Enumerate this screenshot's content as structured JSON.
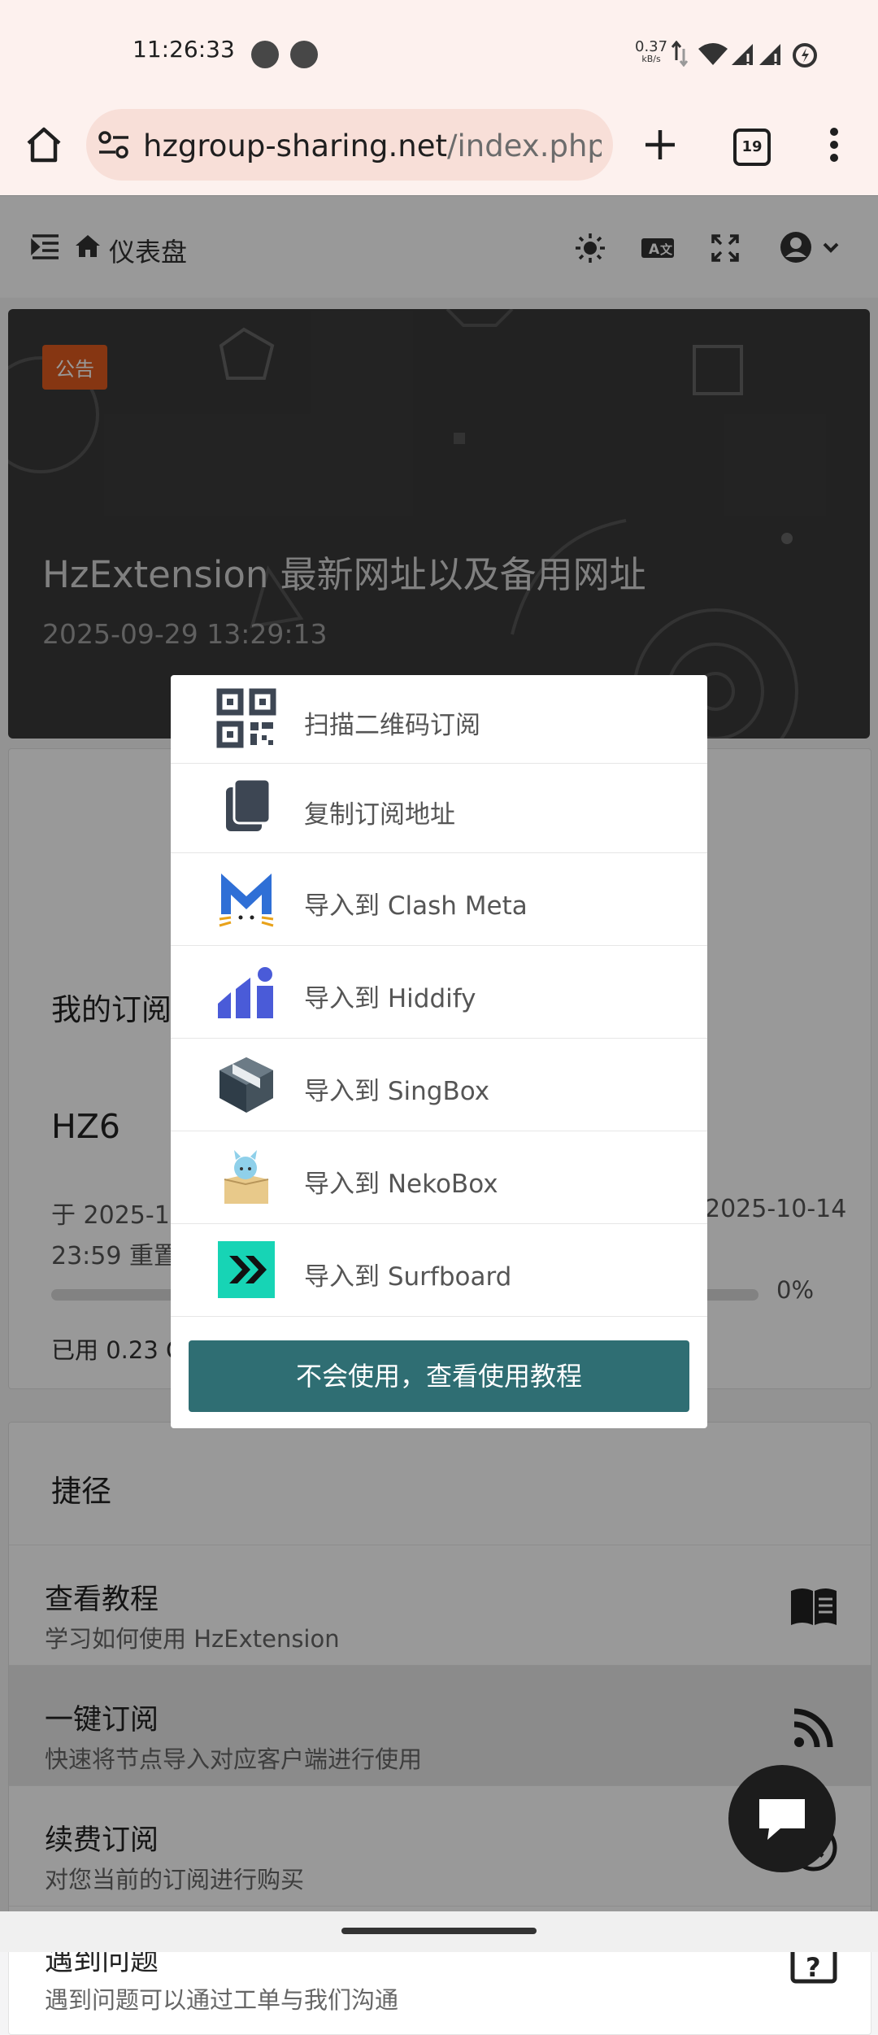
{
  "status": {
    "time": "11:26:33",
    "net_speed": "0.37",
    "net_unit": "kB/s"
  },
  "browser": {
    "url_main": "hzgroup-sharing.net",
    "url_rest": "/index.php#/da",
    "tab_count": "19"
  },
  "header": {
    "title": "仪表盘"
  },
  "announcement": {
    "badge": "公告",
    "title": "HzExtension 最新网址以及备用网址",
    "date": "2025-09-29 13:29:13"
  },
  "subscription": {
    "section_title": "我的订阅",
    "plan": "HZ6",
    "reset_line_left": "于 2025-10",
    "reset_line_right": "2025-10-14",
    "reset_line2": "23:59 重置",
    "usage_percent": "0%",
    "usage_fraction": 0,
    "used_text": "已用 0.23 G"
  },
  "shortcuts": {
    "title": "捷径",
    "items": [
      {
        "title": "查看教程",
        "desc": "学习如何使用 HzExtension",
        "icon": "book-icon"
      },
      {
        "title": "一键订阅",
        "desc": "快速将节点导入对应客户端进行使用",
        "icon": "rss-icon"
      },
      {
        "title": "续费订阅",
        "desc": "对您当前的订阅进行购买",
        "icon": "clock-icon"
      },
      {
        "title": "遇到问题",
        "desc": "遇到问题可以通过工单与我们沟通",
        "icon": "question-icon"
      }
    ]
  },
  "popup": {
    "items": [
      {
        "label": "扫描二维码订阅",
        "icon": "qr-code-icon"
      },
      {
        "label": "复制订阅地址",
        "icon": "copy-icon"
      },
      {
        "label": "导入到 Clash Meta",
        "icon": "clash-meta-icon"
      },
      {
        "label": "导入到 Hiddify",
        "icon": "hiddify-icon"
      },
      {
        "label": "导入到 SingBox",
        "icon": "singbox-icon"
      },
      {
        "label": "导入到 NekoBox",
        "icon": "nekobox-icon"
      },
      {
        "label": "导入到 Surfboard",
        "icon": "surfboard-icon"
      }
    ],
    "help_button": "不会使用，查看使用教程"
  },
  "colors": {
    "accent": "#2f6e73",
    "badge": "#e05a1f",
    "surfboard": "#17d4b5",
    "hiddify": "#4a5bd8",
    "clash": "#2f6fd6"
  }
}
